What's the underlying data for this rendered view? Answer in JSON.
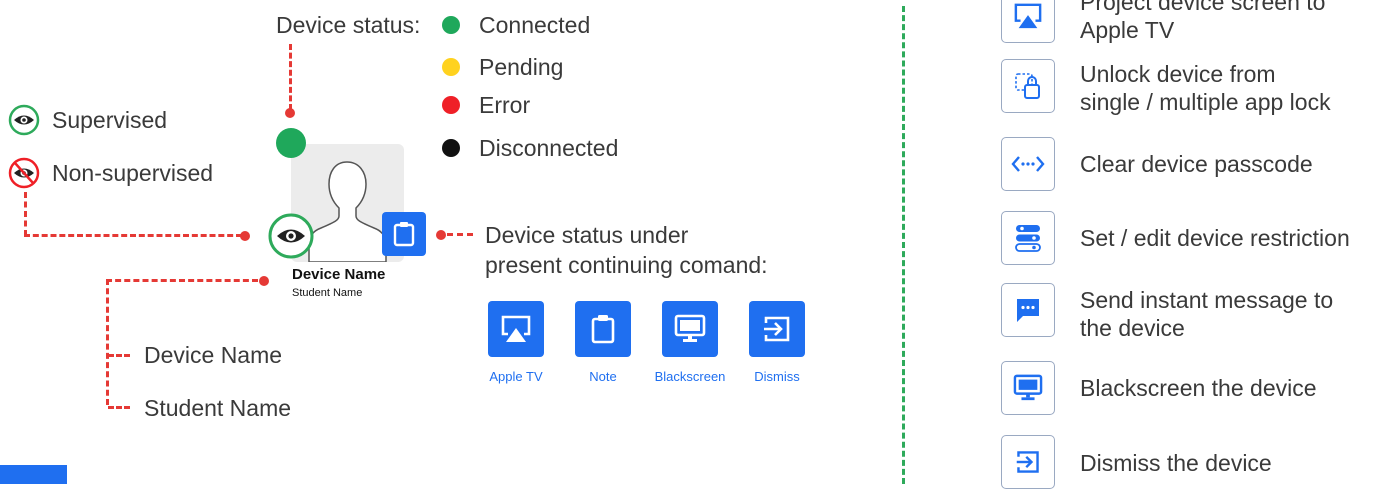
{
  "colors": {
    "connected": "#1fa85b",
    "pending": "#ffd21f",
    "error": "#ef2027",
    "disconnected": "#111111",
    "accent": "#1f6ff0",
    "callout": "#e53935"
  },
  "status_legend": {
    "title": "Device status:",
    "items": [
      {
        "label": "Connected",
        "icon": "green-dot"
      },
      {
        "label": "Pending",
        "icon": "yellow-dot"
      },
      {
        "label": "Error",
        "icon": "red-dot"
      },
      {
        "label": "Disconnected",
        "icon": "black-dot"
      }
    ]
  },
  "supervision": {
    "supervised": "Supervised",
    "non_supervised": "Non-supervised"
  },
  "device_card": {
    "device_name": "Device Name",
    "student_name": "Student Name"
  },
  "name_callouts": {
    "device_name": "Device Name",
    "student_name": "Student Name"
  },
  "continuing_command": {
    "title_line1": "Device status under",
    "title_line2": "present continuing comand:",
    "buttons": [
      {
        "label": "Apple TV",
        "icon": "airplay-icon"
      },
      {
        "label": "Note",
        "icon": "clipboard-icon"
      },
      {
        "label": "Blackscreen",
        "icon": "monitor-icon"
      },
      {
        "label": "Dismiss",
        "icon": "exit-icon"
      }
    ]
  },
  "commands": [
    {
      "line1": "Project device screen to",
      "line2": "Apple TV",
      "icon": "airplay-icon"
    },
    {
      "line1": "Unlock device from",
      "line2": "single / multiple app lock",
      "icon": "unlock-icon"
    },
    {
      "line1": "Clear device passcode",
      "line2": "",
      "icon": "code-icon"
    },
    {
      "line1": "Set / edit device restriction",
      "line2": "",
      "icon": "restriction-icon"
    },
    {
      "line1": "Send instant message to",
      "line2": "the device",
      "icon": "message-icon"
    },
    {
      "line1": "Blackscreen the device",
      "line2": "",
      "icon": "monitor-icon"
    },
    {
      "line1": "Dismiss the device",
      "line2": "",
      "icon": "exit-icon"
    }
  ]
}
